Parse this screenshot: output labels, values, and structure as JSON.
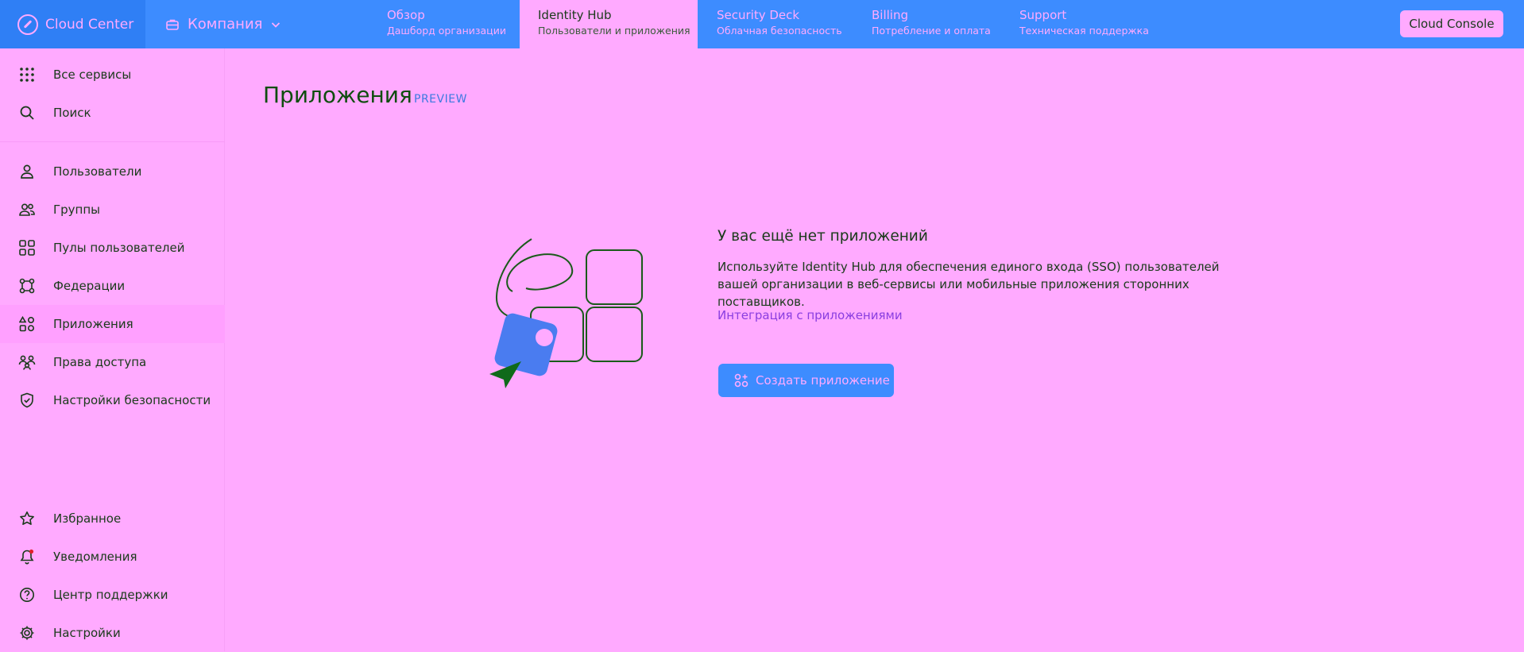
{
  "brand": {
    "name": "Cloud Center"
  },
  "company": {
    "label": "Компания"
  },
  "nav_tabs": [
    {
      "title": "Обзор",
      "subtitle": "Дашборд организации"
    },
    {
      "title": "Identity Hub",
      "subtitle": "Пользователи и приложения"
    },
    {
      "title": "Security Deck",
      "subtitle": "Облачная безопасность"
    },
    {
      "title": "Billing",
      "subtitle": "Потребление и оплата"
    },
    {
      "title": "Support",
      "subtitle": "Техническая поддержка"
    }
  ],
  "console_button": "Cloud Console",
  "sidebar": {
    "top_items": [
      {
        "label": "Все сервисы",
        "icon": "grid-icon"
      },
      {
        "label": "Поиск",
        "icon": "search-icon"
      }
    ],
    "items": [
      {
        "label": "Пользователи",
        "icon": "user-icon"
      },
      {
        "label": "Группы",
        "icon": "users-icon"
      },
      {
        "label": "Пулы пользователей",
        "icon": "user-pool-icon"
      },
      {
        "label": "Федерации",
        "icon": "federation-icon"
      },
      {
        "label": "Приложения",
        "icon": "apps-icon"
      },
      {
        "label": "Права доступа",
        "icon": "access-icon"
      },
      {
        "label": "Настройки безопасности",
        "icon": "shield-icon"
      }
    ],
    "bottom_items": [
      {
        "label": "Избранное",
        "icon": "star-icon"
      },
      {
        "label": "Уведомления",
        "icon": "bell-icon"
      },
      {
        "label": "Центр поддержки",
        "icon": "help-icon"
      },
      {
        "label": "Настройки",
        "icon": "gear-icon"
      }
    ]
  },
  "main": {
    "title": "Приложения",
    "badge": "PREVIEW",
    "empty_state": {
      "title": "У вас ещё нет приложений",
      "text": "Используйте Identity Hub для обеспечения единого входа (SSO) пользователей вашей организации в веб-сервисы или мобильные приложения сторонних поставщиков.",
      "link": "Интеграция с приложениями",
      "button": "Создать приложение"
    }
  },
  "colors": {
    "accent": "#3d8cff",
    "background": "#ffaaff",
    "text": "#1a3a1a",
    "link": "#8a3ee0"
  }
}
